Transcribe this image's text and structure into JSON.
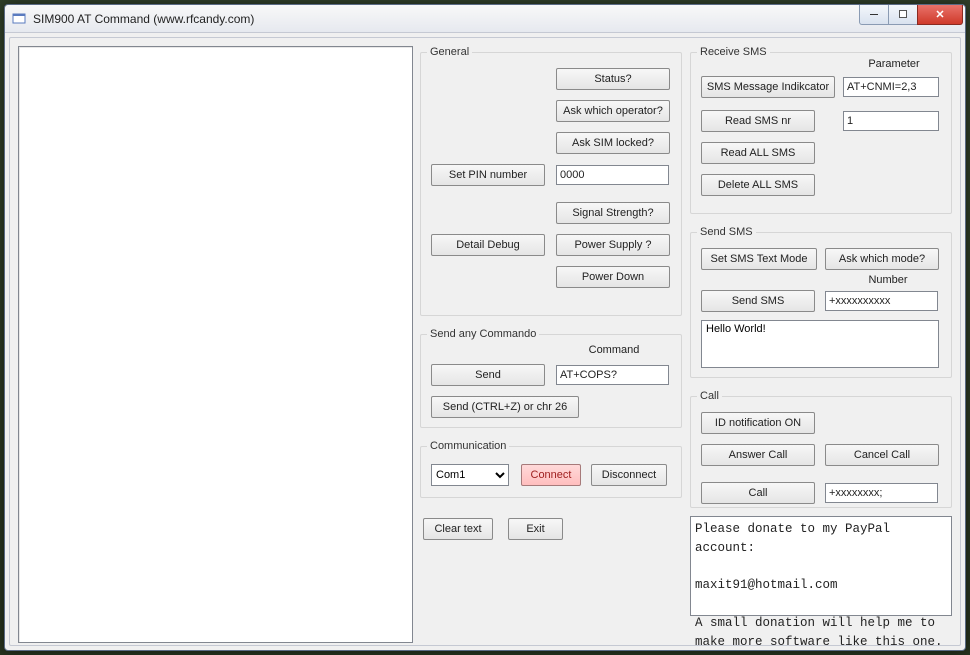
{
  "window": {
    "title": "SIM900 AT Command (www.rfcandy.com)"
  },
  "general": {
    "legend": "General",
    "status_btn": "Status?",
    "ask_operator_btn": "Ask which operator?",
    "ask_sim_locked_btn": "Ask SIM locked?",
    "set_pin_btn": "Set PIN number",
    "pin_value": "0000",
    "signal_btn": "Signal Strength?",
    "detail_debug_btn": "Detail Debug",
    "power_supply_btn": "Power Supply ?",
    "power_down_btn": "Power Down"
  },
  "send_any": {
    "legend": "Send any Commando",
    "send_btn": "Send",
    "command_label": "Command",
    "command_value": "AT+COPS?",
    "send_ctrlz_btn": "Send (CTRL+Z) or chr 26"
  },
  "comm": {
    "legend": "Communication",
    "port_selected": "Com1",
    "connect_btn": "Connect",
    "disconnect_btn": "Disconnect"
  },
  "bottom": {
    "clear_btn": "Clear text",
    "exit_btn": "Exit"
  },
  "receive_sms": {
    "legend": "Receive SMS",
    "param_label": "Parameter",
    "sms_indicator_btn": "SMS Message Indikcator",
    "param_value": "AT+CNMI=2,3",
    "read_sms_nr_btn": "Read SMS nr",
    "read_sms_nr_value": "1",
    "read_all_btn": "Read ALL SMS",
    "delete_all_btn": "Delete ALL SMS"
  },
  "send_sms": {
    "legend": "Send SMS",
    "set_text_mode_btn": "Set SMS Text Mode",
    "ask_mode_btn": "Ask which mode?",
    "number_label": "Number",
    "send_sms_btn": "Send SMS",
    "number_value": "+xxxxxxxxxx",
    "message_value": "Hello World!"
  },
  "call": {
    "legend": "Call",
    "id_notify_btn": "ID notification ON",
    "answer_btn": "Answer Call",
    "cancel_btn": "Cancel Call",
    "call_btn": "Call",
    "number_value": "+xxxxxxxx;"
  },
  "donate": {
    "text": "Please donate to my PayPal account:\n\nmaxit91@hotmail.com\n\nA small donation will help me to\nmake more software like this one."
  }
}
